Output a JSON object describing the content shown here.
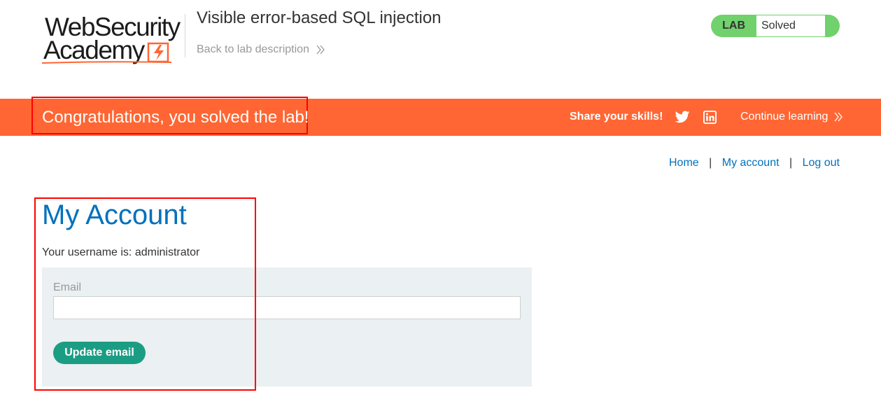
{
  "header": {
    "logo": {
      "line1": "WebSecurity",
      "line2": "Academy"
    },
    "lab_title": "Visible error-based SQL injection",
    "back_link": "Back to lab description",
    "lab_status": {
      "label": "LAB",
      "value": "Solved",
      "color": "#70d16d"
    }
  },
  "banner": {
    "message": "Congratulations, you solved the lab!",
    "share_label": "Share your skills!",
    "continue_label": "Continue learning",
    "background_color": "#ff6633"
  },
  "nav": {
    "home": "Home",
    "sep1": "|",
    "my_account": "My account",
    "sep2": "|",
    "log_out": "Log out"
  },
  "main": {
    "title": "My Account",
    "username_line": "Your username is: administrator",
    "email_label": "Email",
    "email_value": "",
    "update_button": "Update email",
    "accent_color": "#0071bc",
    "button_color": "#1b9d84"
  },
  "icons": {
    "back": "chevron-double-right-icon",
    "continue": "chevron-double-right-icon",
    "twitter": "twitter-icon",
    "linkedin": "linkedin-icon",
    "logo_mark": "lightning-bolt-icon"
  }
}
